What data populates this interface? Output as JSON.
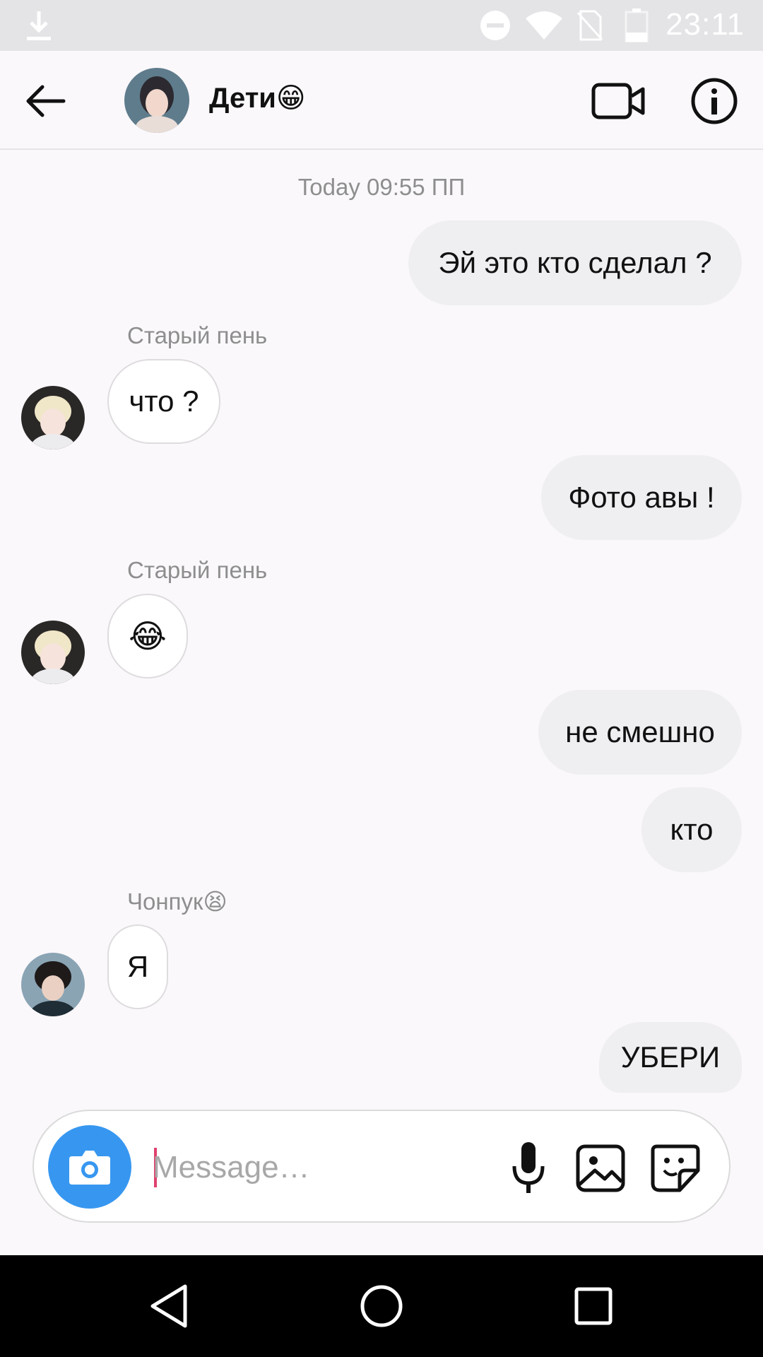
{
  "status_bar": {
    "time": "23:11"
  },
  "header": {
    "title": "Дети😁",
    "back_icon": "arrow-left-icon",
    "video_icon": "video-camera-icon",
    "info_icon": "info-icon"
  },
  "thread": {
    "timestamp": "Today 09:55 ПП",
    "messages": [
      {
        "text": "Эй это кто сделал ?",
        "direction": "outgoing"
      },
      {
        "sender": "Старый пень",
        "text": "что ?",
        "direction": "incoming"
      },
      {
        "text": "Фото авы !",
        "direction": "outgoing"
      },
      {
        "sender": "Старый пень",
        "text": "😂",
        "direction": "incoming"
      },
      {
        "text": "не смешно",
        "direction": "outgoing"
      },
      {
        "text": "кто",
        "direction": "outgoing"
      },
      {
        "sender": "Чонпук😫",
        "text": "Я",
        "direction": "incoming"
      },
      {
        "text": "УБЕРИ",
        "direction": "outgoing"
      }
    ]
  },
  "composer": {
    "placeholder": "Message…",
    "camera_icon": "camera-icon",
    "mic_icon": "microphone-icon",
    "gallery_icon": "gallery-icon",
    "sticker_icon": "sticker-icon"
  },
  "colors": {
    "accent": "#3797f0",
    "bubble_out": "#efeef1",
    "background": "#faf8fb"
  }
}
